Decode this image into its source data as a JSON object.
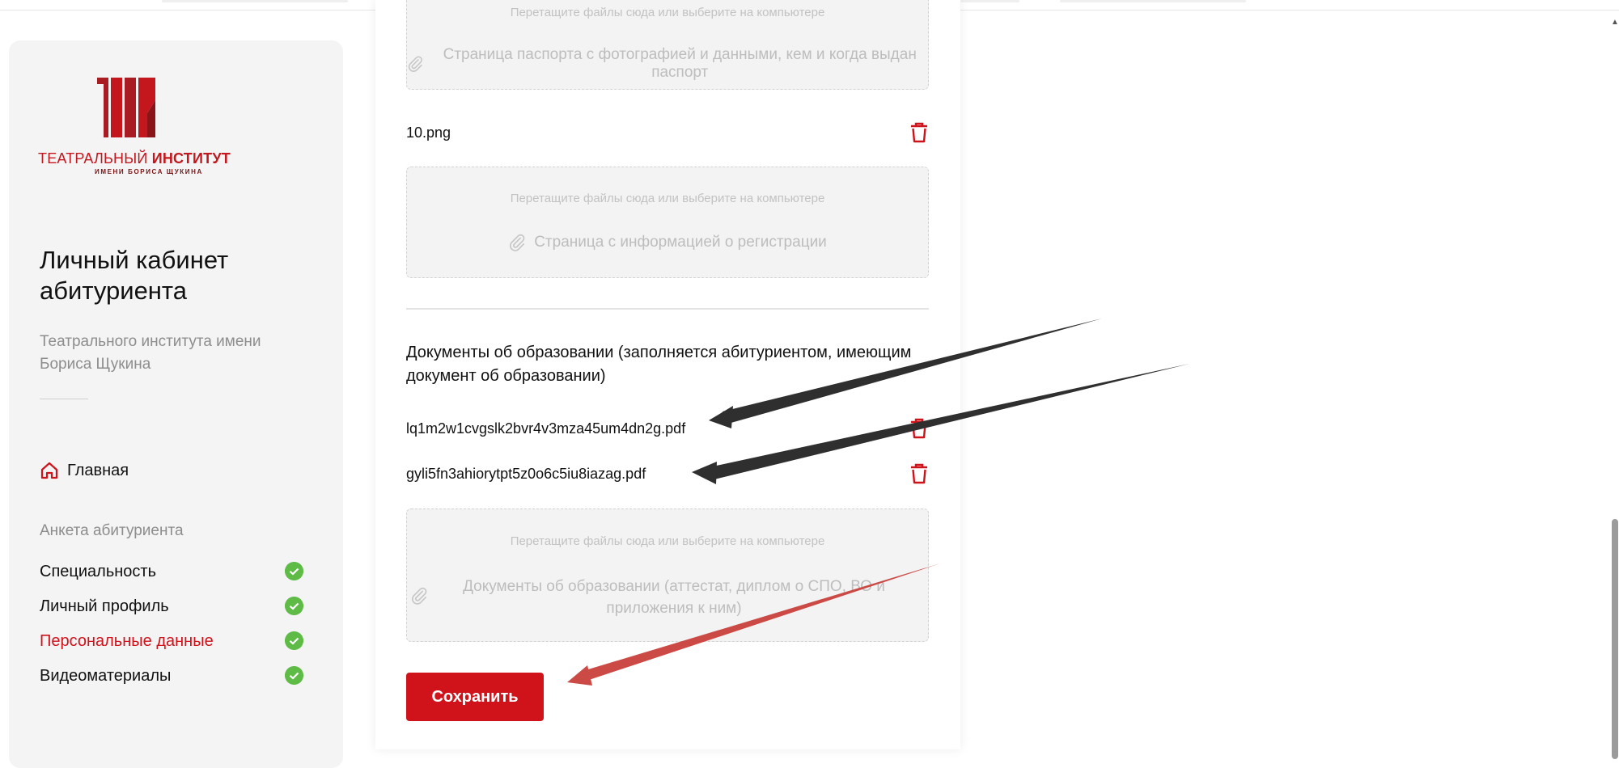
{
  "sidebar": {
    "logo": {
      "line1_normal": "ТЕАТРАЛЬНЫЙ",
      "line1_bold": "ИНСТИТУТ",
      "line2": "ИМЕНИ БОРИСА ЩУКИНА"
    },
    "title": "Личный кабинет абитуриента",
    "subtitle": "Театрального института имени Бориса Щукина",
    "home_label": "Главная",
    "section_label": "Анкета абитуриента",
    "items": [
      {
        "label": "Специальность",
        "status": "done"
      },
      {
        "label": "Личный профиль",
        "status": "done"
      },
      {
        "label": "Персональные данные",
        "status": "done",
        "active": true
      },
      {
        "label": "Видеоматериалы",
        "status": "done"
      }
    ]
  },
  "main": {
    "upload_hint": "Перетащите файлы сюда или выберите на компьютере",
    "passport_zone_label": "Страница паспорта с фотографией и данными, кем и когда выдан паспорт",
    "passport_file": "10.png",
    "registration_zone_label": "Страница с информацией о регистрации",
    "education_title": "Документы об образовании (заполняется абитуриентом, имеющим документ об образовании)",
    "education_files": [
      "lq1m2w1cvgslk2bvr4v3mza45um4dn2g.pdf",
      "gyli5fn3ahiorytpt5z0o6c5iu8iazag.pdf"
    ],
    "education_zone_label": "Документы об образовании (аттестат, диплом о СПО, ВО и приложения к ним)",
    "save_label": "Сохранить"
  },
  "colors": {
    "accent": "#d0121b",
    "check": "#5dbb46",
    "annotation_dark": "#2f2f2f",
    "annotation_red": "#cc4a45"
  }
}
